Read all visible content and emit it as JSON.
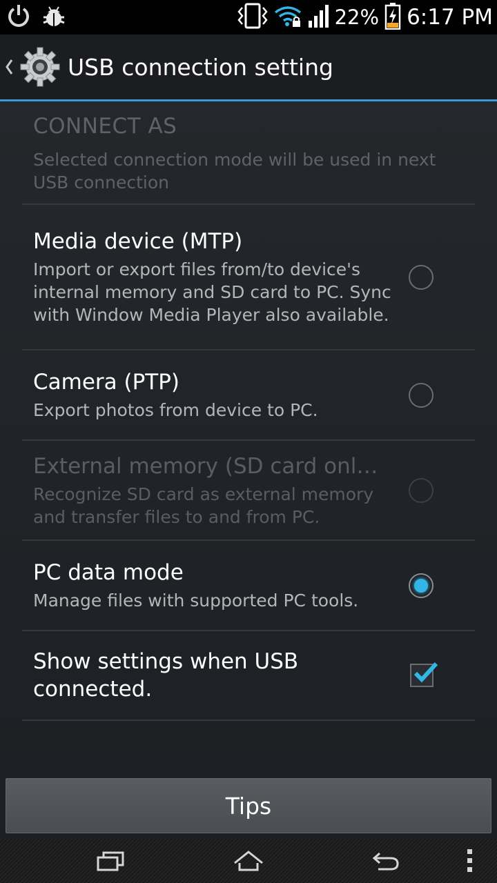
{
  "status_bar": {
    "icons_left": [
      "power-icon",
      "debug-bug-icon"
    ],
    "icons_right": [
      "vibrate-icon",
      "wifi-lock-icon",
      "signal-icon",
      "battery-charging-icon"
    ],
    "battery_percent": "22%",
    "time": "6:17 PM"
  },
  "action_bar": {
    "title": "USB connection setting",
    "icon": "settings-gear-icon"
  },
  "header": {
    "title": "CONNECT AS",
    "subtitle": "Selected connection mode will be used in next USB connection"
  },
  "options": [
    {
      "title": "Media device (MTP)",
      "subtitle": "Import or export files from/to device's internal memory and SD card to PC. Sync with Window Media Player also available.",
      "selected": false,
      "enabled": true
    },
    {
      "title": "Camera (PTP)",
      "subtitle": "Export photos from device to PC.",
      "selected": false,
      "enabled": true
    },
    {
      "title": "External memory (SD card onl…",
      "subtitle": "Recognize SD card as external memory and transfer files to and from PC.",
      "selected": false,
      "enabled": false
    },
    {
      "title": "PC data mode",
      "subtitle": "Manage files with supported PC tools.",
      "selected": true,
      "enabled": true
    }
  ],
  "show_settings": {
    "title": "Show settings when USB connected.",
    "checked": true
  },
  "tips_button": {
    "label": "Tips"
  },
  "nav_bar": {
    "icons": [
      "recent-apps-icon",
      "home-icon",
      "back-icon",
      "menu-icon"
    ]
  },
  "colors": {
    "accent": "#33b5e5",
    "divider_accent": "#3a9bd9"
  }
}
